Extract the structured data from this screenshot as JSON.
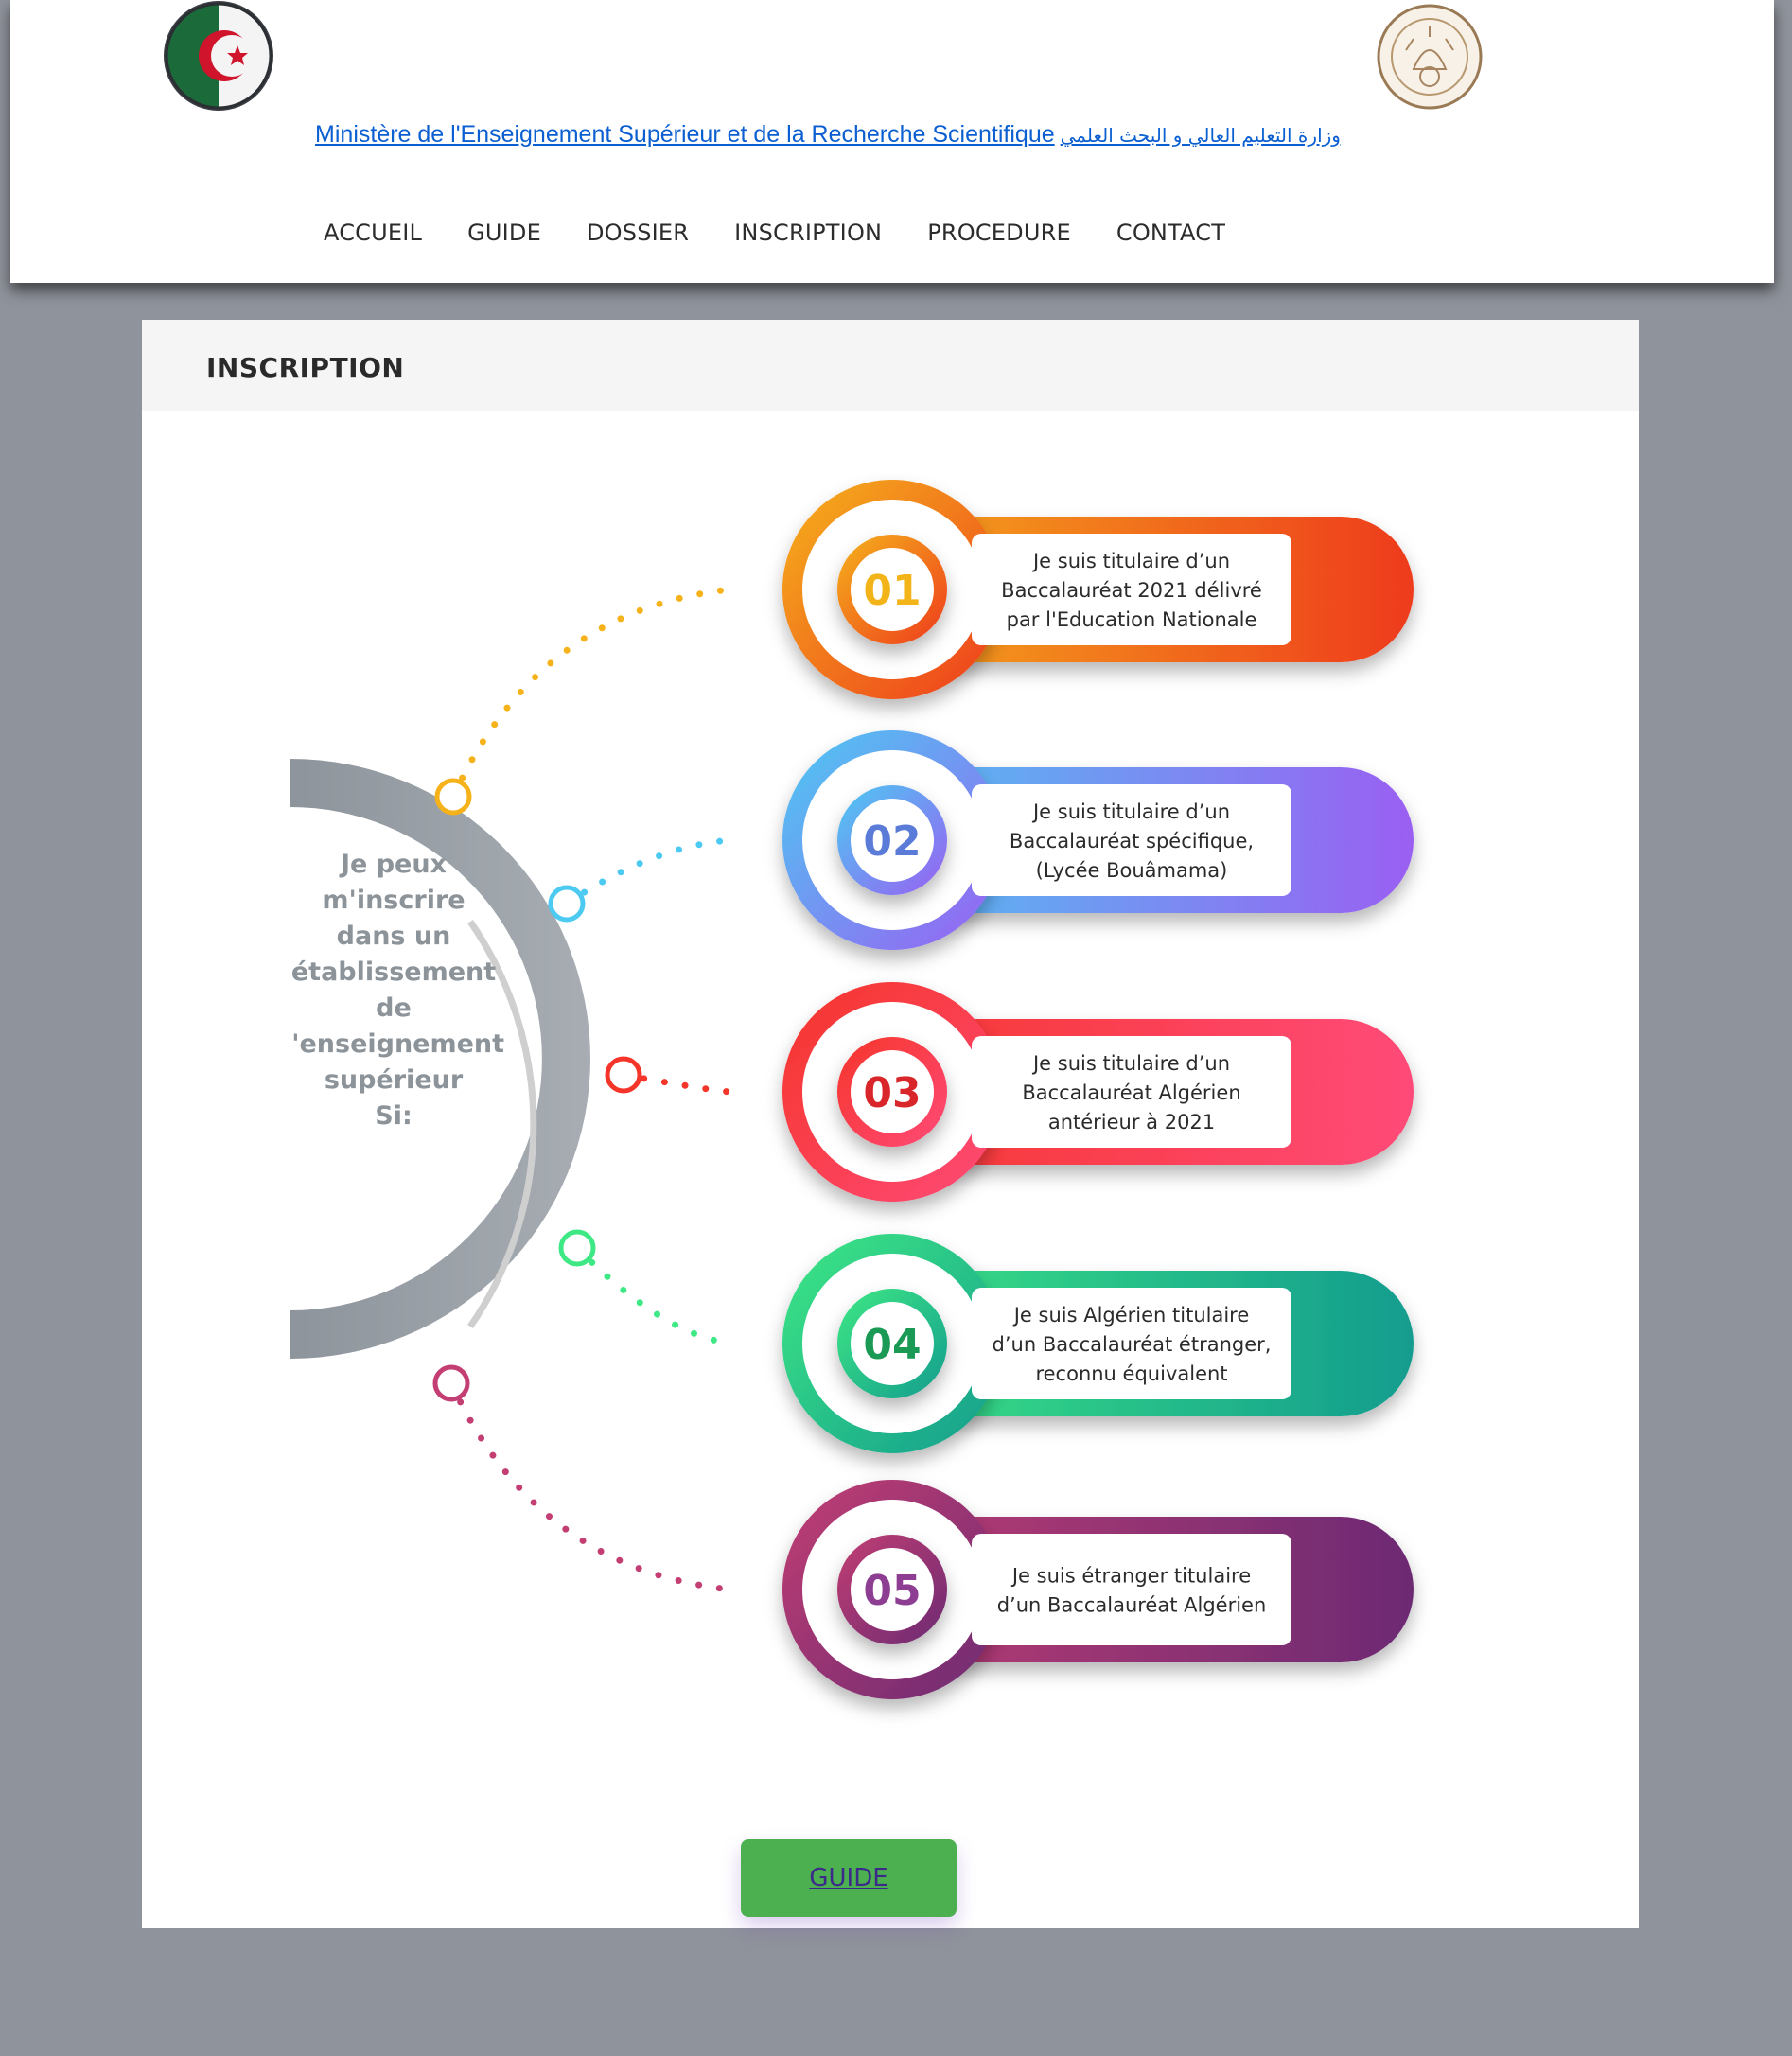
{
  "header": {
    "ministry_fr": "Ministère de l'Enseignement Supérieur et de la Recherche Scientifique",
    "ministry_ar": "وزارة التعليم العالي و البحث العلمي",
    "flag_icon": "algeria-flag-icon",
    "seal_icon": "national-emblem-icon"
  },
  "nav": {
    "items": [
      "ACCUEIL",
      "GUIDE",
      "DOSSIER",
      "INSCRIPTION",
      "PROCEDURE",
      "CONTACT"
    ]
  },
  "card": {
    "title": "INSCRIPTION"
  },
  "infographic": {
    "center_lines": [
      "Je peux",
      "m'inscrire",
      "dans un",
      "établissement",
      "de",
      "l'enseignement",
      "supérieur",
      "Si:"
    ],
    "steps": [
      {
        "number": "01",
        "lines": [
          "Je suis titulaire d’un",
          "Baccalauréat 2021 délivré",
          "par l'Education Nationale"
        ],
        "color_start": "#f5b21a",
        "color_end": "#ee3b1e",
        "number_color": "#f2b418"
      },
      {
        "number": "02",
        "lines": [
          "Je suis titulaire d’un",
          "Baccalauréat spécifique,",
          "(Lycée Bouâmama)"
        ],
        "color_start": "#4ccaf2",
        "color_end": "#9a5ff2",
        "number_color": "#5b7bd8"
      },
      {
        "number": "03",
        "lines": [
          "Je suis titulaire d’un",
          "Baccalauréat Algérien",
          "antérieur à 2021"
        ],
        "color_start": "#f5352a",
        "color_end": "#ff4a78",
        "number_color": "#d8262b"
      },
      {
        "number": "04",
        "lines": [
          "Je suis Algérien titulaire",
          "d’un Baccalauréat étranger,",
          "reconnu  équivalent"
        ],
        "color_start": "#3ee884",
        "color_end": "#139c8e",
        "number_color": "#1b9a56"
      },
      {
        "number": "05",
        "lines": [
          "Je suis étranger titulaire",
          "d’un Baccalauréat Algérien"
        ],
        "color_start": "#c23e73",
        "color_end": "#6c2a73",
        "number_color": "#8d3e93"
      }
    ]
  },
  "guide_button": {
    "label": "GUIDE"
  }
}
